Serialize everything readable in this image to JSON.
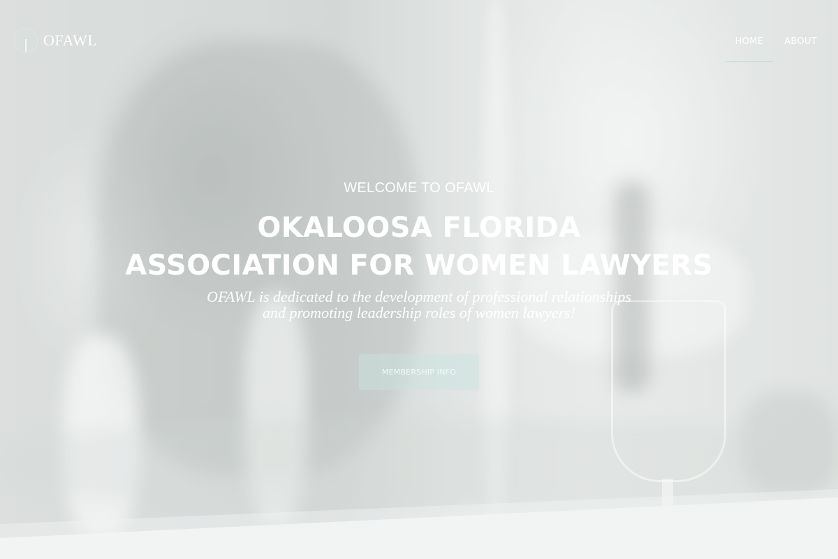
{
  "header": {
    "logo_text": "OFAWL",
    "nav": [
      {
        "label": "HOME",
        "active": true
      },
      {
        "label": "ABOUT",
        "active": false
      }
    ]
  },
  "hero": {
    "eyebrow": "WELCOME TO OFAWL",
    "title_line1": "OKALOOSA FLORIDA",
    "title_line2": "ASSOCIATION FOR WOMEN LAWYERS",
    "subtitle_line1": "OFAWL is dedicated to the development of professional relationships",
    "subtitle_line2": "and promoting leadership roles of women lawyers!",
    "cta_label": "MEMBERSHIP INFO"
  },
  "colors": {
    "accent": "#b7d8d2",
    "button_bg": "#c8e4e0",
    "text": "#ffffff",
    "band": "#f2f4f3"
  },
  "icons": {
    "logo": "tree-icon"
  }
}
